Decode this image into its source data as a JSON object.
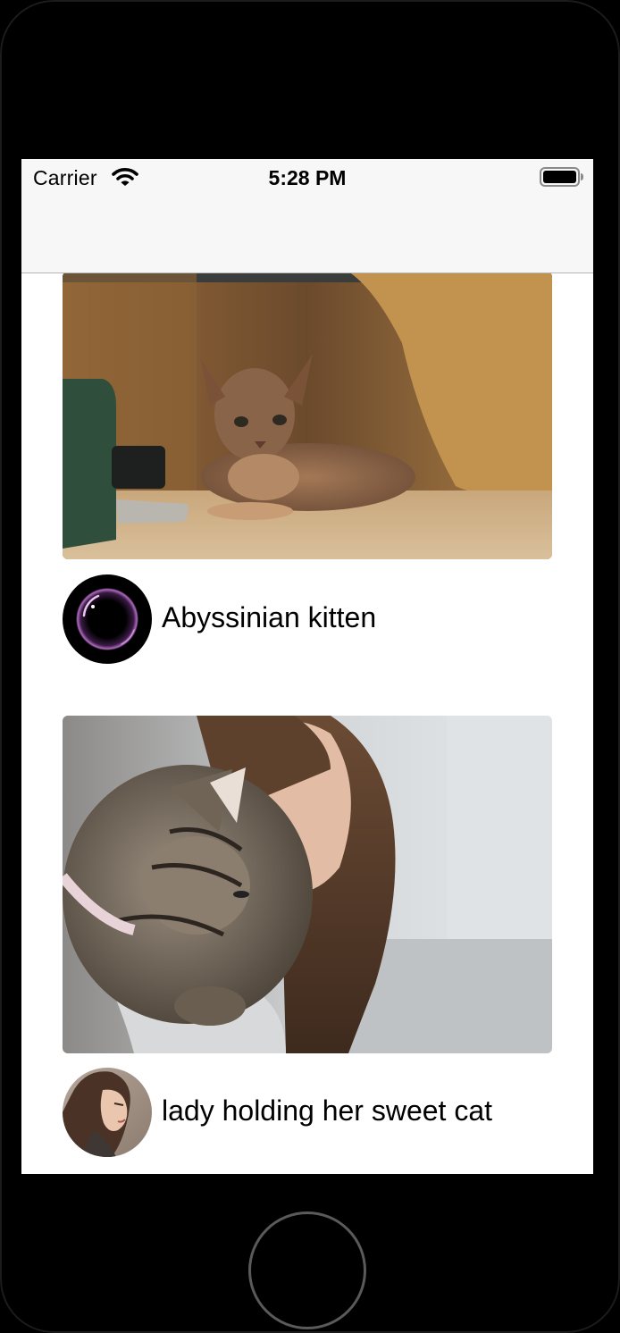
{
  "status_bar": {
    "carrier": "Carrier",
    "time": "5:28 PM",
    "wifi_icon": "wifi-icon",
    "battery_icon": "battery-icon"
  },
  "nav_bar": {
    "title": ""
  },
  "feed": {
    "items": [
      {
        "caption": "Abyssinian kitten",
        "photo_icon": "kitten-photo",
        "avatar_icon": "bubble-avatar"
      },
      {
        "caption": "lady holding her sweet cat",
        "photo_icon": "woman-cat-photo",
        "avatar_icon": "woman-profile-avatar"
      }
    ]
  },
  "colors": {
    "status_bar_bg": "#f7f7f7",
    "screen_bg": "#ffffff",
    "device_bezel": "#000000",
    "text": "#000000"
  }
}
